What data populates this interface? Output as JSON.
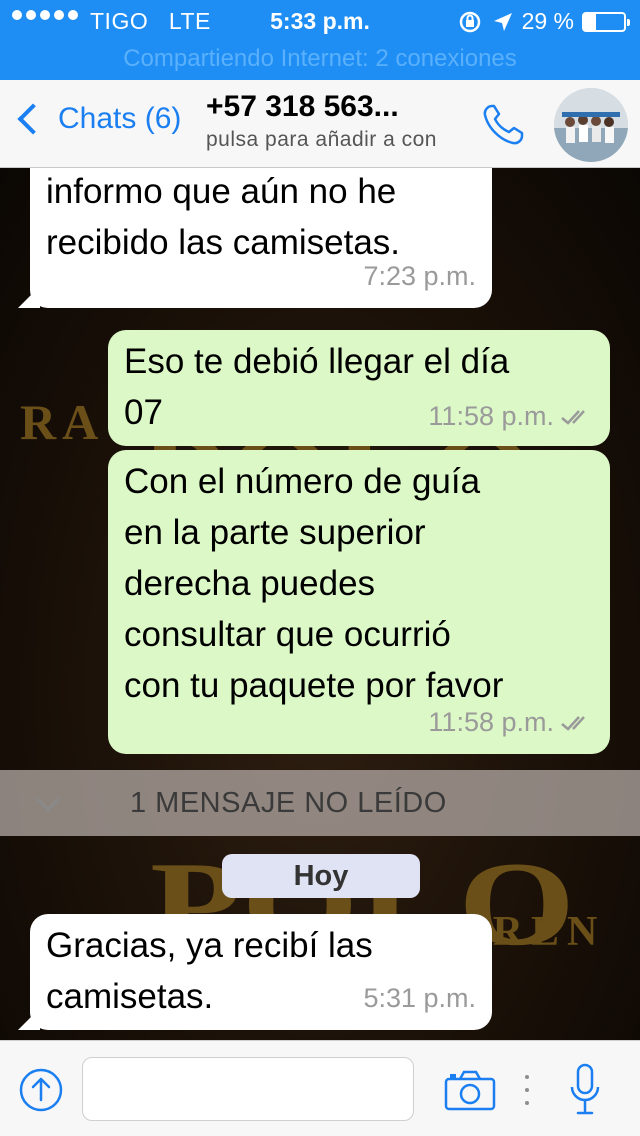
{
  "status_bar": {
    "carrier": "TIGO",
    "network": "LTE",
    "time": "5:33 p.m.",
    "battery_percent": "29 %",
    "battery_level": 0.29,
    "hotspot": "Compartiendo Internet: 2 conexiones"
  },
  "nav": {
    "back_label": "Chats (6)",
    "contact_name": "+57 318 563...",
    "contact_sub": "pulsa para añadir a con",
    "call_icon": "phone-icon",
    "avatar_icon": "group-photo-avatar"
  },
  "messages": [
    {
      "direction": "in",
      "text_lines": [
        "informo que aún no he",
        "recibido las camisetas."
      ],
      "time": "7:23 p.m."
    },
    {
      "direction": "out",
      "text_lines": [
        "Eso te debió llegar el día",
        "07"
      ],
      "time": "11:58 p.m.",
      "status": "read"
    },
    {
      "direction": "out",
      "text_lines": [
        "Con el número de guía",
        "en la parte superior",
        "derecha puedes",
        "consultar que ocurrió",
        "con tu paquete por favor"
      ],
      "time": "11:58 p.m.",
      "status": "read"
    },
    {
      "direction": "in",
      "text_lines": [
        "Gracias, ya recibí las",
        "camisetas."
      ],
      "time": "5:31 p.m."
    }
  ],
  "unread_banner": "1 MENSAJE NO LEÍDO",
  "day_label": "Hoy",
  "input_bar": {
    "placeholder": "",
    "attach_icon": "arrow-up-circle-icon",
    "camera_icon": "camera-icon",
    "mic_icon": "microphone-icon"
  },
  "colors": {
    "accent": "#1b7ff1",
    "outgoing_bubble": "#dcf8c6",
    "incoming_bubble": "#ffffff",
    "status_bar": "#1e8ef5"
  }
}
